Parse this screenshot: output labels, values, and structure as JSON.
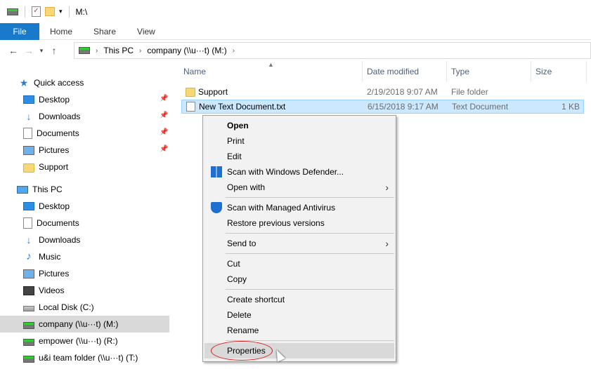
{
  "window": {
    "title": "M:\\"
  },
  "ribbon": {
    "tabs": [
      "File",
      "Home",
      "Share",
      "View"
    ]
  },
  "address": {
    "segments": [
      "This PC",
      "company (\\\\u···t) (M:)"
    ]
  },
  "nav": {
    "quick_access": "Quick access",
    "quick_items": [
      "Desktop",
      "Downloads",
      "Documents",
      "Pictures",
      "Support"
    ],
    "this_pc": "This PC",
    "pc_items": [
      "Desktop",
      "Documents",
      "Downloads",
      "Music",
      "Pictures",
      "Videos",
      "Local Disk (C:)",
      "company (\\\\u···t) (M:)",
      "empower (\\\\u···t) (R:)",
      "u&i team folder (\\\\u···t) (T:)"
    ]
  },
  "columns": [
    "Name",
    "Date modified",
    "Type",
    "Size"
  ],
  "files": [
    {
      "name": "Support",
      "date": "2/19/2018 9:07 AM",
      "type": "File folder",
      "size": ""
    },
    {
      "name": "New Text Document.txt",
      "date": "6/15/2018 9:17 AM",
      "type": "Text Document",
      "size": "1 KB"
    }
  ],
  "context_menu": {
    "open": "Open",
    "print": "Print",
    "edit": "Edit",
    "scan_defender": "Scan with Windows Defender...",
    "open_with": "Open with",
    "scan_managed": "Scan with Managed Antivirus",
    "restore": "Restore previous versions",
    "send_to": "Send to",
    "cut": "Cut",
    "copy": "Copy",
    "create_shortcut": "Create shortcut",
    "delete": "Delete",
    "rename": "Rename",
    "properties": "Properties"
  },
  "colors": {
    "file_tab": "#1979ca",
    "selection": "#cce8ff",
    "annotation": "#e01818"
  }
}
